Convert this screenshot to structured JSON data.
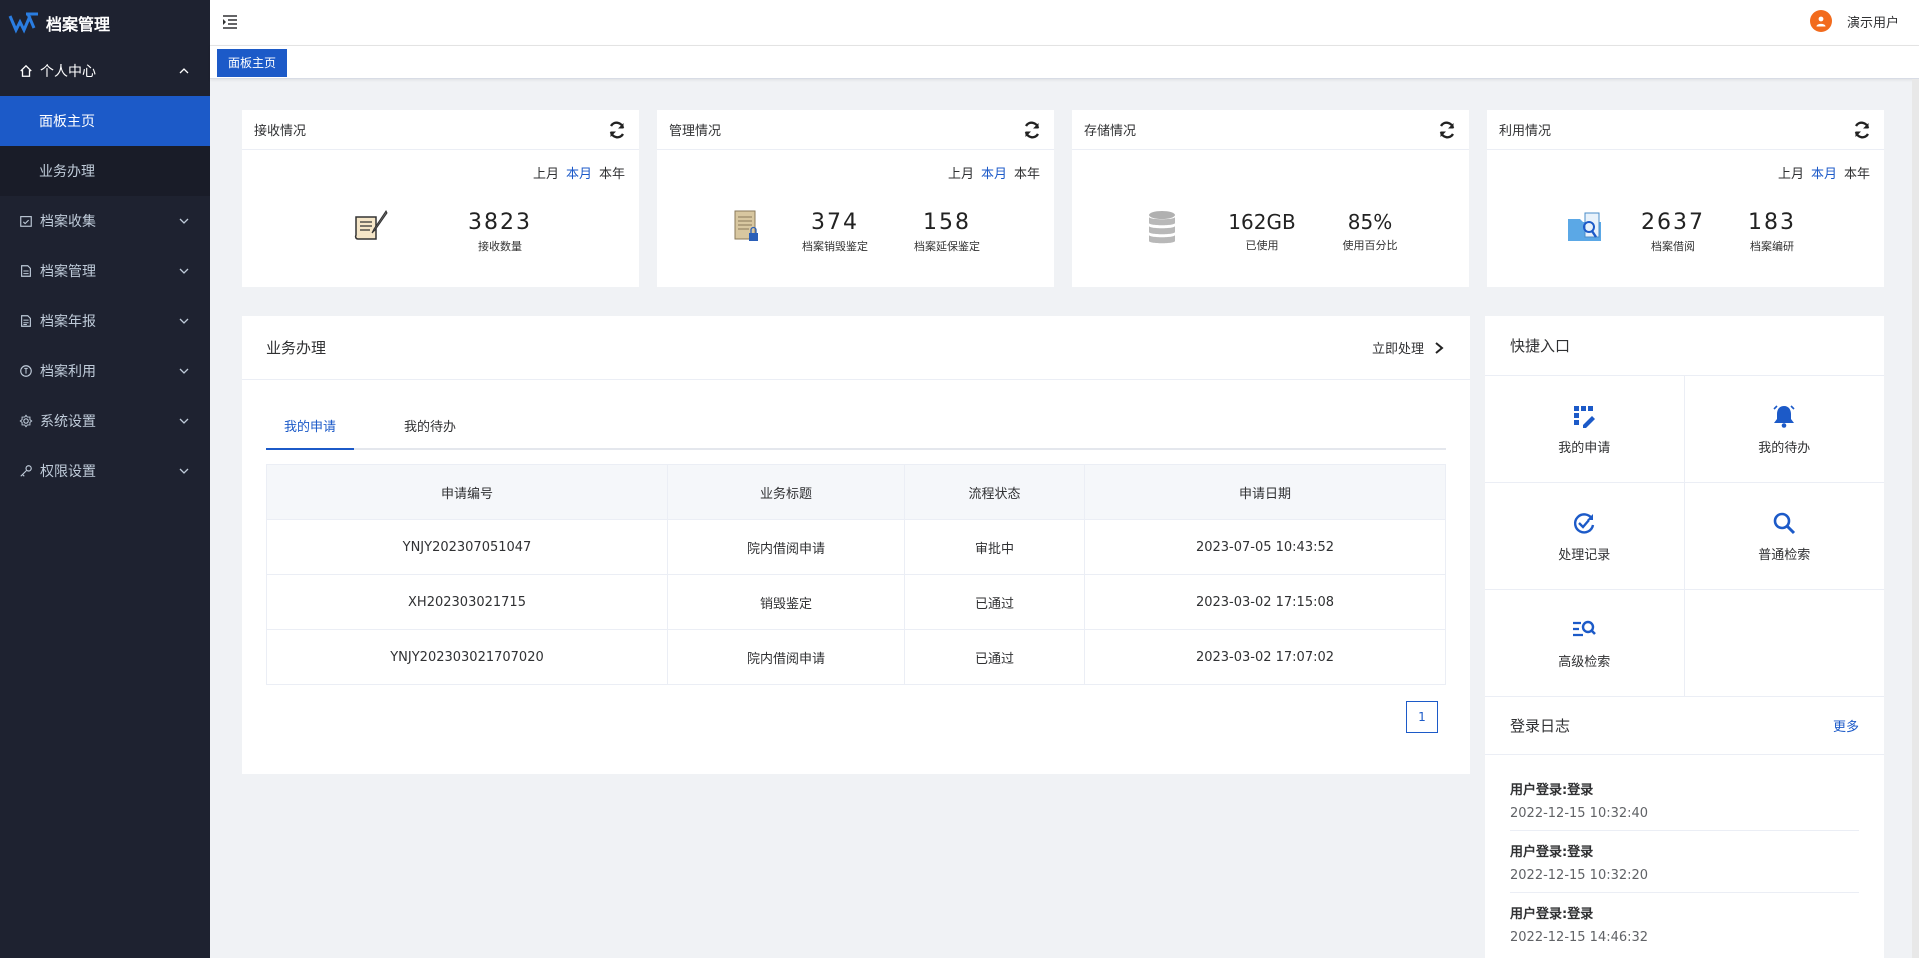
{
  "app": {
    "title": "档案管理"
  },
  "sidebar": {
    "groups": [
      {
        "label": "个人中心",
        "icon": "home-icon",
        "open": true,
        "items": [
          {
            "label": "面板主页",
            "active": true
          },
          {
            "label": "业务办理",
            "active": false
          }
        ]
      },
      {
        "label": "档案收集",
        "icon": "calendar-check-icon"
      },
      {
        "label": "档案管理",
        "icon": "document-icon"
      },
      {
        "label": "档案年报",
        "icon": "report-icon"
      },
      {
        "label": "档案利用",
        "icon": "info-circle-icon"
      },
      {
        "label": "系统设置",
        "icon": "gear-icon"
      },
      {
        "label": "权限设置",
        "icon": "key-icon"
      }
    ]
  },
  "topbar": {
    "user_name": "演示用户"
  },
  "tags": {
    "active": "面板主页"
  },
  "stats": [
    {
      "title": "接收情况",
      "periods": [
        "上月",
        "本月",
        "本年"
      ],
      "active_period": "本月",
      "icon": "scroll-quill-icon",
      "values": [
        {
          "num": "3823",
          "label": "接收数量"
        }
      ]
    },
    {
      "title": "管理情况",
      "periods": [
        "上月",
        "本月",
        "本年"
      ],
      "active_period": "本月",
      "icon": "locked-document-icon",
      "values": [
        {
          "num": "374",
          "label": "档案销毁鉴定"
        },
        {
          "num": "158",
          "label": "档案延保鉴定"
        }
      ]
    },
    {
      "title": "存储情况",
      "icon": "database-icon",
      "values": [
        {
          "num": "162GB",
          "label": "已使用"
        },
        {
          "num": "85%",
          "label": "使用百分比"
        }
      ]
    },
    {
      "title": "利用情况",
      "periods": [
        "上月",
        "本月",
        "本年"
      ],
      "active_period": "本月",
      "icon": "folder-search-icon",
      "values": [
        {
          "num": "2637",
          "label": "档案借阅"
        },
        {
          "num": "183",
          "label": "档案编研"
        }
      ]
    }
  ],
  "business": {
    "title": "业务办理",
    "action": "立即处理",
    "tabs": [
      "我的申请",
      "我的待办"
    ],
    "active_tab": "我的申请",
    "columns": [
      "申请编号",
      "业务标题",
      "流程状态",
      "申请日期"
    ],
    "rows": [
      [
        "YNJY202307051047",
        "院内借阅申请",
        "审批中",
        "2023-07-05 10:43:52"
      ],
      [
        "XH202303021715",
        "销毁鉴定",
        "已通过",
        "2023-03-02 17:15:08"
      ],
      [
        "YNJY202303021707020",
        "院内借阅申请",
        "已通过",
        "2023-03-02 17:07:02"
      ]
    ],
    "page": "1"
  },
  "quick": {
    "title": "快捷入口",
    "items": [
      {
        "label": "我的申请",
        "icon": "apply-icon"
      },
      {
        "label": "我的待办",
        "icon": "bell-icon"
      },
      {
        "label": "处理记录",
        "icon": "history-check-icon"
      },
      {
        "label": "普通检索",
        "icon": "search-icon"
      },
      {
        "label": "高级检索",
        "icon": "advanced-search-icon"
      }
    ]
  },
  "login_log": {
    "title": "登录日志",
    "more": "更多",
    "entries": [
      {
        "title": "用户登录:登录",
        "time": "2022-12-15 10:32:40"
      },
      {
        "title": "用户登录:登录",
        "time": "2022-12-15 10:32:20"
      },
      {
        "title": "用户登录:登录",
        "time": "2022-12-15 14:46:32"
      }
    ]
  },
  "colors": {
    "primary": "#1c5ac8",
    "sidebar_bg": "#1e2230",
    "avatar": "#f26b1d"
  }
}
